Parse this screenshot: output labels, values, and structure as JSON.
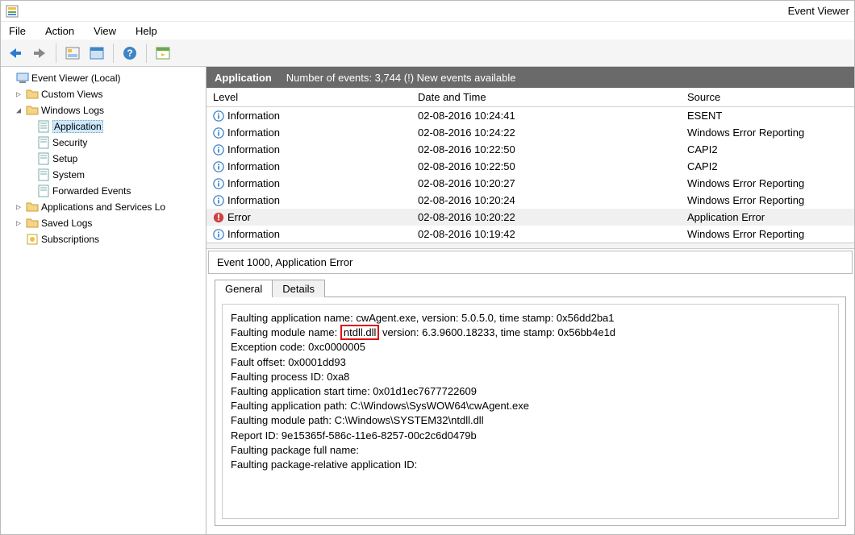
{
  "window": {
    "title": "Event Viewer"
  },
  "menu": {
    "file": "File",
    "action": "Action",
    "view": "View",
    "help": "Help"
  },
  "tree": {
    "root": "Event Viewer (Local)",
    "custom": "Custom Views",
    "winlogs": "Windows Logs",
    "app": "Application",
    "sec": "Security",
    "setup": "Setup",
    "sys": "System",
    "fwd": "Forwarded Events",
    "apps": "Applications and Services Lo",
    "saved": "Saved Logs",
    "subs": "Subscriptions"
  },
  "header": {
    "name": "Application",
    "sub": "Number of events: 3,744 (!) New events available"
  },
  "columns": {
    "level": "Level",
    "date": "Date and Time",
    "source": "Source"
  },
  "events": [
    {
      "level": "Information",
      "date": "02-08-2016 10:24:41",
      "source": "ESENT",
      "type": "info"
    },
    {
      "level": "Information",
      "date": "02-08-2016 10:24:22",
      "source": "Windows Error Reporting",
      "type": "info"
    },
    {
      "level": "Information",
      "date": "02-08-2016 10:22:50",
      "source": "CAPI2",
      "type": "info"
    },
    {
      "level": "Information",
      "date": "02-08-2016 10:22:50",
      "source": "CAPI2",
      "type": "info"
    },
    {
      "level": "Information",
      "date": "02-08-2016 10:20:27",
      "source": "Windows Error Reporting",
      "type": "info"
    },
    {
      "level": "Information",
      "date": "02-08-2016 10:20:24",
      "source": "Windows Error Reporting",
      "type": "info"
    },
    {
      "level": "Error",
      "date": "02-08-2016 10:20:22",
      "source": "Application Error",
      "type": "error",
      "selected": true
    },
    {
      "level": "Information",
      "date": "02-08-2016 10:19:42",
      "source": "Windows Error Reporting",
      "type": "info"
    }
  ],
  "detail": {
    "title": "Event 1000, Application Error",
    "tabs": {
      "general": "General",
      "details": "Details"
    },
    "lines": {
      "l1a": "Faulting application name: cwAgent.exe, version: 5.0.5.0, time stamp: 0x56dd2ba1",
      "l2a": "Faulting module name:",
      "l2b": "ntdll.dll",
      "l2c": " version: 6.3.9600.18233, time stamp: 0x56bb4e1d",
      "l3": "Exception code: 0xc0000005",
      "l4": "Fault offset: 0x0001dd93",
      "l5": "Faulting process ID: 0xa8",
      "l6": "Faulting application start time: 0x01d1ec7677722609",
      "l7": "Faulting application path: C:\\Windows\\SysWOW64\\cwAgent.exe",
      "l8": "Faulting module path: C:\\Windows\\SYSTEM32\\ntdll.dll",
      "l9": "Report ID: 9e15365f-586c-11e6-8257-00c2c6d0479b",
      "l10": "Faulting package full name:",
      "l11": "Faulting package-relative application ID:"
    }
  }
}
